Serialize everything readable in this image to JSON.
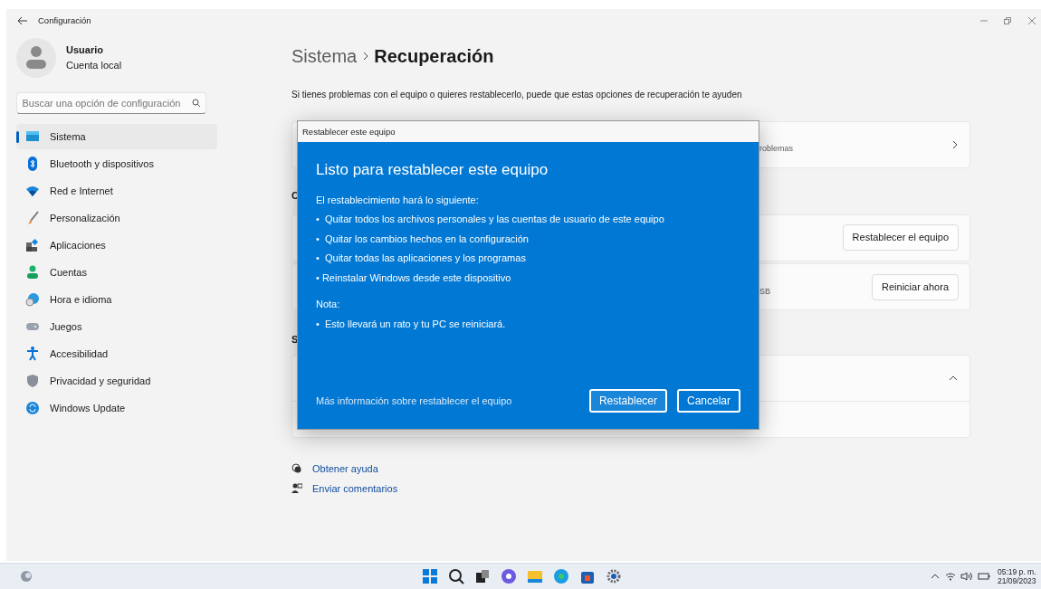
{
  "window": {
    "title": "Configuración"
  },
  "user": {
    "name": "Usuario",
    "account": "Cuenta local"
  },
  "search": {
    "placeholder": "Buscar una opción de configuración"
  },
  "sidebar": {
    "items": [
      {
        "label": "Sistema",
        "selected": true
      },
      {
        "label": "Bluetooth y dispositivos",
        "selected": false
      },
      {
        "label": "Red e Internet",
        "selected": false
      },
      {
        "label": "Personalización",
        "selected": false
      },
      {
        "label": "Aplicaciones",
        "selected": false
      },
      {
        "label": "Cuentas",
        "selected": false
      },
      {
        "label": "Hora e idioma",
        "selected": false
      },
      {
        "label": "Juegos",
        "selected": false
      },
      {
        "label": "Accesibilidad",
        "selected": false
      },
      {
        "label": "Privacidad y seguridad",
        "selected": false
      },
      {
        "label": "Windows Update",
        "selected": false
      }
    ]
  },
  "page": {
    "breadcrumb_parent": "Sistema",
    "title": "Recuperación",
    "description": "Si tienes problemas con el equipo o quieres restablecerlo, puede que estas opciones de recuperación te ayuden"
  },
  "content": [
    {
      "kind": "link_card",
      "text": "roblemas"
    },
    {
      "kind": "heading",
      "text": "C"
    },
    {
      "kind": "card",
      "button": "Restablecer el equipo"
    },
    {
      "kind": "card",
      "text": "SB",
      "button": "Reiniciar ahora"
    },
    {
      "kind": "heading",
      "text": "S"
    },
    {
      "kind": "expander",
      "expanded": true
    }
  ],
  "help_links": [
    {
      "label": "Obtener ayuda"
    },
    {
      "label": "Enviar comentarios"
    }
  ],
  "dialog": {
    "title": "Restablecer este equipo",
    "heading": "Listo para restablecer este equipo",
    "intro": "El restablecimiento hará lo siguiente:",
    "bullets": [
      "•  Quitar todos los archivos personales y las cuentas de usuario de este equipo",
      "•  Quitar los cambios hechos en la configuración",
      "•  Quitar todas las aplicaciones y los programas",
      "• Reinstalar Windows desde este dispositivo"
    ],
    "note_label": "Nota:",
    "note_bullets": [
      "•  Esto llevará un rato y tu PC se reiniciará."
    ],
    "link": "Más información sobre restablecer el equipo",
    "buttons": [
      {
        "label": "Restablecer"
      },
      {
        "label": "Cancelar"
      }
    ]
  },
  "taskbar": {
    "time": "05:19 p. m.",
    "date": "21/09/2023"
  }
}
